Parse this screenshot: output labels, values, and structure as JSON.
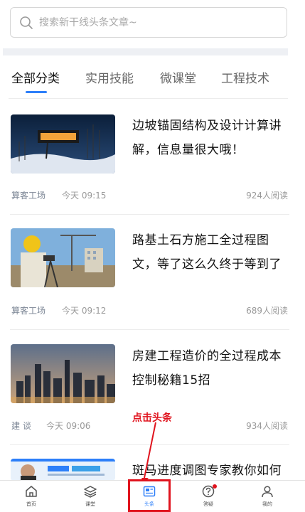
{
  "search": {
    "placeholder": "搜索新干线头条文章~"
  },
  "tabs": [
    {
      "label": "全部分类"
    },
    {
      "label": "实用技能"
    },
    {
      "label": "微课堂"
    },
    {
      "label": "工程技术"
    }
  ],
  "articles": [
    {
      "title": "边坡锚固结构及设计计算讲解，信息量很大哦！",
      "source": "算客工场",
      "time": "今天 09:15",
      "reads": "924人阅读"
    },
    {
      "title": "路基土石方施工全过程图文，等了这么久终于等到了",
      "source": "算客工场",
      "time": "今天 09:12",
      "reads": "689人阅读"
    },
    {
      "title": "房建工程造价的全过程成本控制秘籍15招",
      "source": "建 谈",
      "time": "今天 09:06",
      "reads": "934人阅读"
    },
    {
      "title": "斑马进度调图专家教你如何"
    }
  ],
  "annotation": {
    "text": "点击头条"
  },
  "bottom_nav": [
    {
      "label": "首页",
      "icon": "home-icon"
    },
    {
      "label": "课堂",
      "icon": "layers-icon"
    },
    {
      "label": "头条",
      "icon": "news-icon"
    },
    {
      "label": "答疑",
      "icon": "question-icon"
    },
    {
      "label": "我的",
      "icon": "user-icon"
    }
  ],
  "colors": {
    "accent": "#2d7ff9",
    "highlight": "#e0141e"
  }
}
